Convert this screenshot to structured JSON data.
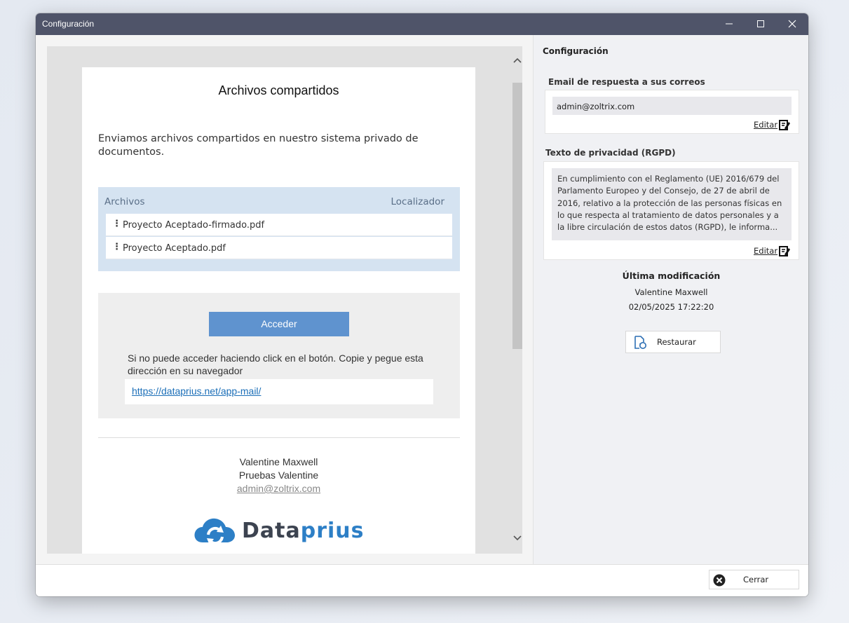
{
  "window": {
    "title": "Configuración"
  },
  "preview": {
    "title": "Archivos compartidos",
    "intro": "Enviamos archivos compartidos en nuestro sistema privado de documentos.",
    "files_header": "Archivos",
    "locator_header": "Localizador",
    "files": [
      {
        "name": "Proyecto Aceptado-firmado.pdf"
      },
      {
        "name": "Proyecto Aceptado.pdf"
      }
    ],
    "access_button": "Acceder",
    "access_note": "Si no puede acceder haciendo click en el botón. Copie y pegue esta dirección en su navegador",
    "access_url": "https://dataprius.net/app-mail/",
    "signature": {
      "name": "Valentine Maxwell",
      "company": "Pruebas Valentine",
      "email": "admin@zoltrix.com"
    },
    "logo": {
      "part1": "Data",
      "part2": "prius",
      "color_dark": "#3c4350",
      "color_blue": "#2d7fc6"
    }
  },
  "settings": {
    "heading": "Configuración",
    "reply_email_label": "Email de respuesta a sus correos",
    "reply_email_value": "admin@zoltrix.com",
    "edit_label": "Editar",
    "privacy_label": "Texto de privacidad (RGPD)",
    "privacy_text": "En cumplimiento con el Reglamento (UE) 2016/679 del Parlamento Europeo y del Consejo, de 27 de abril de 2016, relativo a la protección de las personas físicas en lo que respecta al tratamiento de datos personales y a la libre circulación de estos datos (RGPD), le informa...",
    "last_mod_title": "Última modificación",
    "last_mod_user": "Valentine Maxwell",
    "last_mod_date": "02/05/2025 17:22:20",
    "restore_button": "Restaurar"
  },
  "footer": {
    "close_button": "Cerrar"
  },
  "icons": {
    "edit": "edit-icon",
    "restore": "restore-document-icon",
    "close": "close-circle-icon",
    "cloud": "cloud-sync-icon"
  }
}
